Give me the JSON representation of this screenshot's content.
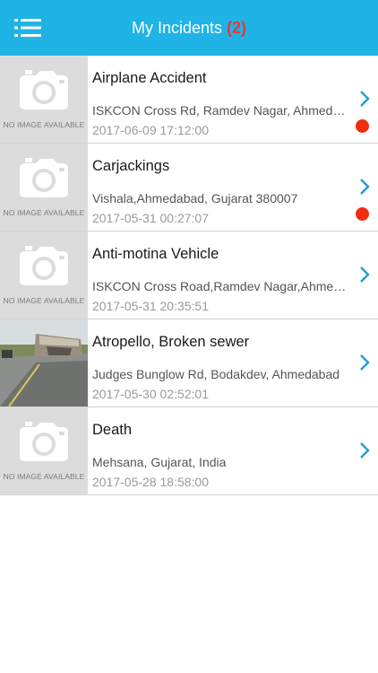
{
  "header": {
    "title": "My Incidents",
    "count": "(2)",
    "menu_icon": "hamburger-menu-icon"
  },
  "placeholder_text": "NO IMAGE AVAILABLE",
  "incidents": [
    {
      "title": "Airplane Accident",
      "address": "ISKCON Cross Rd, Ramdev Nagar, Ahmedabad, Gujarat",
      "date": "2017-06-09 17:12:00",
      "unread": true,
      "has_image": false
    },
    {
      "title": "Carjackings",
      "address": "Vishala,Ahmedabad, Gujarat 380007",
      "date": "2017-05-31 00:27:07",
      "unread": true,
      "has_image": false
    },
    {
      "title": "Anti-motina Vehicle",
      "address": "ISKCON Cross Road,Ramdev Nagar,Ahmedabad",
      "date": "2017-05-31 20:35:51",
      "unread": false,
      "has_image": false
    },
    {
      "title": "Atropello, Broken sewer",
      "address": "Judges Bunglow Rd, Bodakdev, Ahmedabad",
      "date": "2017-05-30 02:52:01",
      "unread": false,
      "has_image": true
    },
    {
      "title": "Death",
      "address": "Mehsana, Gujarat, India",
      "date": "2017-05-28 18:58:00",
      "unread": false,
      "has_image": false
    }
  ],
  "colors": {
    "header_bg": "#1fb3e6",
    "count": "#e53935",
    "unread_dot": "#f02d0e",
    "chevron": "#1f9fd6"
  }
}
